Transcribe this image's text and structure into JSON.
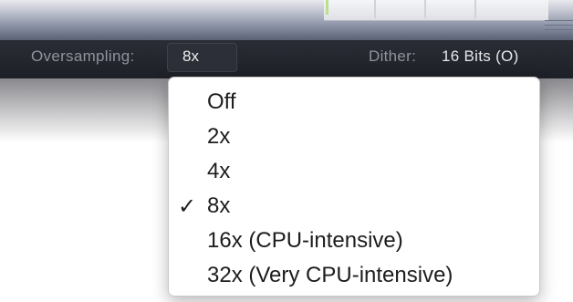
{
  "toolbar": {
    "oversampling_label": "Oversampling:",
    "oversampling_value": "8x",
    "dither_label": "Dither:",
    "dither_value": "16 Bits (O)"
  },
  "oversampling_menu": {
    "selected": "8x",
    "checkmark": "✓",
    "items": [
      "Off",
      "2x",
      "4x",
      "8x",
      "16x (CPU-intensive)",
      "32x (Very CPU-intensive)"
    ]
  },
  "colors": {
    "bar_background": "#1f2128",
    "meter_active": "#b9df8f",
    "menu_background": "#ffffff"
  }
}
